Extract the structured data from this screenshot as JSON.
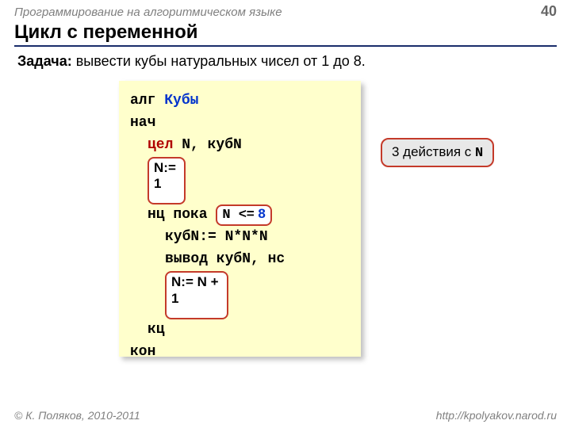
{
  "header": {
    "course": "Программирование на алгоритмическом языке",
    "page": "40"
  },
  "title": "Цикл с переменной",
  "task": {
    "label": "Задача:",
    "text": " вывести кубы натуральных чисел от 1 до 8."
  },
  "code": {
    "l1_alg": "алг ",
    "l1_name": "Кубы",
    "l2": "нач",
    "l3_cel": "цел",
    "l3_rest": " N, кубN",
    "l4_a": "N:=",
    "l4_b": "1",
    "l5_a": "нц пока ",
    "l5_hi_a": "N ",
    "l5_hi_op": "<=",
    "l5_hi_n": " 8",
    "l6": "кубN:= N*N*N",
    "l7": "вывод кубN, нс",
    "l8_a": "N:= N + ",
    "l8_b": "1",
    "l9": "кц",
    "l10": "кон"
  },
  "callout": {
    "a": "3 действия с ",
    "b": "N"
  },
  "footer": {
    "left": "© К. Поляков, 2010-2011",
    "right": "http://kpolyakov.narod.ru"
  }
}
